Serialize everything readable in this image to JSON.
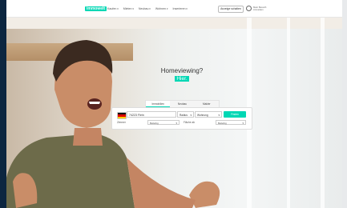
{
  "header": {
    "logo_text": "immowelt",
    "nav": [
      "Kaufen",
      "Mieten",
      "Neubau",
      "Wohnen",
      "Inserieren"
    ],
    "cta": "Anzeige schalten",
    "profile_line1": "Mein Bereich",
    "profile_line2": "Anmelden"
  },
  "hero": {
    "headline": "Homeviewing?",
    "highlight": "Hier."
  },
  "tabs": [
    "Immobilien",
    "Neubau",
    "Makler"
  ],
  "search": {
    "location": "74223 Flein",
    "distance": "Radius",
    "type": "Wohnung",
    "button": "Finden",
    "rooms_label": "Zimmer",
    "rooms_value": "Beliebig",
    "area_label": "Fläche ab",
    "area_value": "Beliebig"
  },
  "colors": {
    "accent": "#00d7b4",
    "sidebar": "#0c2640"
  }
}
